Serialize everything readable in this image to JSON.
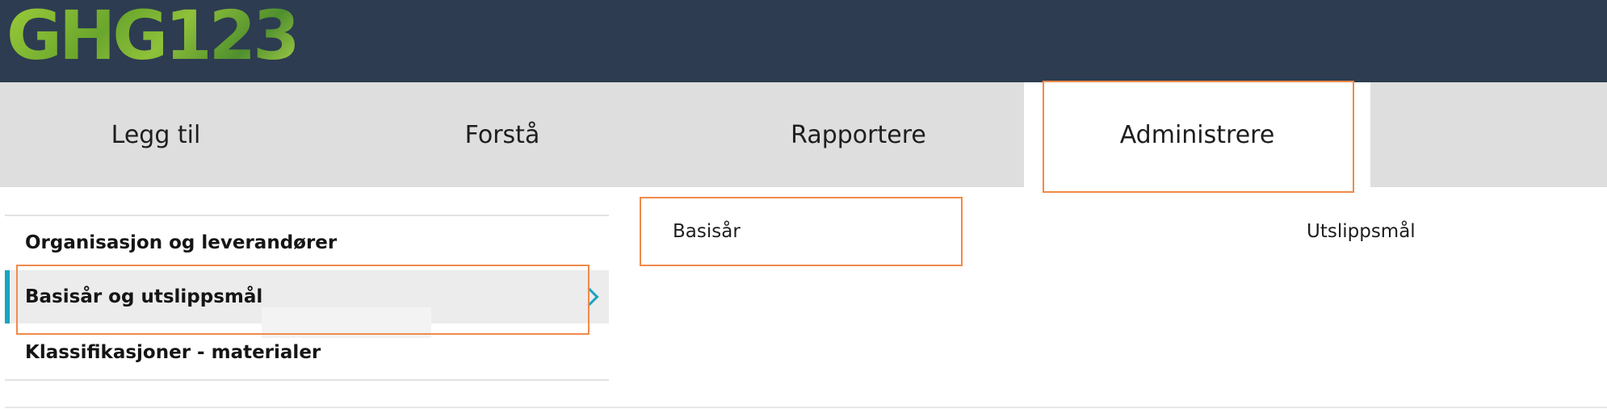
{
  "header": {
    "logo_text": "GHG123"
  },
  "nav": {
    "tabs": [
      {
        "label": "Legg til"
      },
      {
        "label": "Forstå"
      },
      {
        "label": "Rapportere"
      },
      {
        "label": "Administrere"
      }
    ]
  },
  "sidebar": {
    "items": [
      {
        "label": "Organisasjon og leverandører"
      },
      {
        "label": "Basisår og utslippsmål"
      },
      {
        "label": "Klassifikasjoner - materialer"
      }
    ]
  },
  "subtabs": {
    "items": [
      {
        "label": "Basisår"
      },
      {
        "label": "Utslippsmål"
      }
    ]
  },
  "colors": {
    "header_bg": "#2d3c50",
    "nav_bg": "#dedede",
    "accent": "#1aa3bf",
    "highlight": "#f08a4b"
  }
}
